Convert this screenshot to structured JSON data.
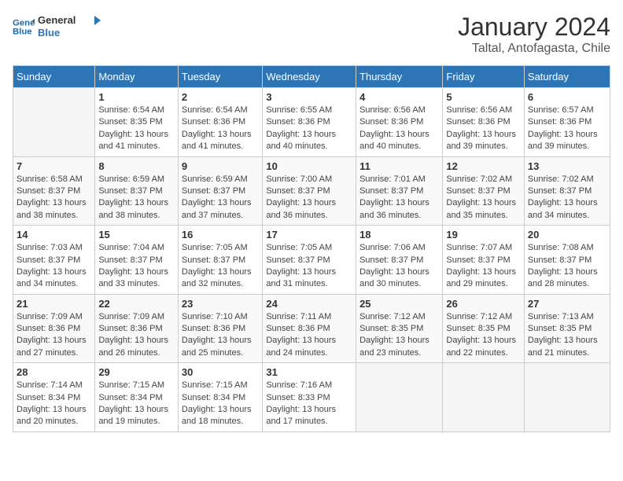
{
  "header": {
    "logo_line1": "General",
    "logo_line2": "Blue",
    "title": "January 2024",
    "subtitle": "Taltal, Antofagasta, Chile"
  },
  "weekdays": [
    "Sunday",
    "Monday",
    "Tuesday",
    "Wednesday",
    "Thursday",
    "Friday",
    "Saturday"
  ],
  "weeks": [
    [
      {
        "day": "",
        "sunrise": "",
        "sunset": "",
        "daylight": ""
      },
      {
        "day": "1",
        "sunrise": "Sunrise: 6:54 AM",
        "sunset": "Sunset: 8:35 PM",
        "daylight": "Daylight: 13 hours and 41 minutes."
      },
      {
        "day": "2",
        "sunrise": "Sunrise: 6:54 AM",
        "sunset": "Sunset: 8:36 PM",
        "daylight": "Daylight: 13 hours and 41 minutes."
      },
      {
        "day": "3",
        "sunrise": "Sunrise: 6:55 AM",
        "sunset": "Sunset: 8:36 PM",
        "daylight": "Daylight: 13 hours and 40 minutes."
      },
      {
        "day": "4",
        "sunrise": "Sunrise: 6:56 AM",
        "sunset": "Sunset: 8:36 PM",
        "daylight": "Daylight: 13 hours and 40 minutes."
      },
      {
        "day": "5",
        "sunrise": "Sunrise: 6:56 AM",
        "sunset": "Sunset: 8:36 PM",
        "daylight": "Daylight: 13 hours and 39 minutes."
      },
      {
        "day": "6",
        "sunrise": "Sunrise: 6:57 AM",
        "sunset": "Sunset: 8:36 PM",
        "daylight": "Daylight: 13 hours and 39 minutes."
      }
    ],
    [
      {
        "day": "7",
        "sunrise": "Sunrise: 6:58 AM",
        "sunset": "Sunset: 8:37 PM",
        "daylight": "Daylight: 13 hours and 38 minutes."
      },
      {
        "day": "8",
        "sunrise": "Sunrise: 6:59 AM",
        "sunset": "Sunset: 8:37 PM",
        "daylight": "Daylight: 13 hours and 38 minutes."
      },
      {
        "day": "9",
        "sunrise": "Sunrise: 6:59 AM",
        "sunset": "Sunset: 8:37 PM",
        "daylight": "Daylight: 13 hours and 37 minutes."
      },
      {
        "day": "10",
        "sunrise": "Sunrise: 7:00 AM",
        "sunset": "Sunset: 8:37 PM",
        "daylight": "Daylight: 13 hours and 36 minutes."
      },
      {
        "day": "11",
        "sunrise": "Sunrise: 7:01 AM",
        "sunset": "Sunset: 8:37 PM",
        "daylight": "Daylight: 13 hours and 36 minutes."
      },
      {
        "day": "12",
        "sunrise": "Sunrise: 7:02 AM",
        "sunset": "Sunset: 8:37 PM",
        "daylight": "Daylight: 13 hours and 35 minutes."
      },
      {
        "day": "13",
        "sunrise": "Sunrise: 7:02 AM",
        "sunset": "Sunset: 8:37 PM",
        "daylight": "Daylight: 13 hours and 34 minutes."
      }
    ],
    [
      {
        "day": "14",
        "sunrise": "Sunrise: 7:03 AM",
        "sunset": "Sunset: 8:37 PM",
        "daylight": "Daylight: 13 hours and 34 minutes."
      },
      {
        "day": "15",
        "sunrise": "Sunrise: 7:04 AM",
        "sunset": "Sunset: 8:37 PM",
        "daylight": "Daylight: 13 hours and 33 minutes."
      },
      {
        "day": "16",
        "sunrise": "Sunrise: 7:05 AM",
        "sunset": "Sunset: 8:37 PM",
        "daylight": "Daylight: 13 hours and 32 minutes."
      },
      {
        "day": "17",
        "sunrise": "Sunrise: 7:05 AM",
        "sunset": "Sunset: 8:37 PM",
        "daylight": "Daylight: 13 hours and 31 minutes."
      },
      {
        "day": "18",
        "sunrise": "Sunrise: 7:06 AM",
        "sunset": "Sunset: 8:37 PM",
        "daylight": "Daylight: 13 hours and 30 minutes."
      },
      {
        "day": "19",
        "sunrise": "Sunrise: 7:07 AM",
        "sunset": "Sunset: 8:37 PM",
        "daylight": "Daylight: 13 hours and 29 minutes."
      },
      {
        "day": "20",
        "sunrise": "Sunrise: 7:08 AM",
        "sunset": "Sunset: 8:37 PM",
        "daylight": "Daylight: 13 hours and 28 minutes."
      }
    ],
    [
      {
        "day": "21",
        "sunrise": "Sunrise: 7:09 AM",
        "sunset": "Sunset: 8:36 PM",
        "daylight": "Daylight: 13 hours and 27 minutes."
      },
      {
        "day": "22",
        "sunrise": "Sunrise: 7:09 AM",
        "sunset": "Sunset: 8:36 PM",
        "daylight": "Daylight: 13 hours and 26 minutes."
      },
      {
        "day": "23",
        "sunrise": "Sunrise: 7:10 AM",
        "sunset": "Sunset: 8:36 PM",
        "daylight": "Daylight: 13 hours and 25 minutes."
      },
      {
        "day": "24",
        "sunrise": "Sunrise: 7:11 AM",
        "sunset": "Sunset: 8:36 PM",
        "daylight": "Daylight: 13 hours and 24 minutes."
      },
      {
        "day": "25",
        "sunrise": "Sunrise: 7:12 AM",
        "sunset": "Sunset: 8:35 PM",
        "daylight": "Daylight: 13 hours and 23 minutes."
      },
      {
        "day": "26",
        "sunrise": "Sunrise: 7:12 AM",
        "sunset": "Sunset: 8:35 PM",
        "daylight": "Daylight: 13 hours and 22 minutes."
      },
      {
        "day": "27",
        "sunrise": "Sunrise: 7:13 AM",
        "sunset": "Sunset: 8:35 PM",
        "daylight": "Daylight: 13 hours and 21 minutes."
      }
    ],
    [
      {
        "day": "28",
        "sunrise": "Sunrise: 7:14 AM",
        "sunset": "Sunset: 8:34 PM",
        "daylight": "Daylight: 13 hours and 20 minutes."
      },
      {
        "day": "29",
        "sunrise": "Sunrise: 7:15 AM",
        "sunset": "Sunset: 8:34 PM",
        "daylight": "Daylight: 13 hours and 19 minutes."
      },
      {
        "day": "30",
        "sunrise": "Sunrise: 7:15 AM",
        "sunset": "Sunset: 8:34 PM",
        "daylight": "Daylight: 13 hours and 18 minutes."
      },
      {
        "day": "31",
        "sunrise": "Sunrise: 7:16 AM",
        "sunset": "Sunset: 8:33 PM",
        "daylight": "Daylight: 13 hours and 17 minutes."
      },
      {
        "day": "",
        "sunrise": "",
        "sunset": "",
        "daylight": ""
      },
      {
        "day": "",
        "sunrise": "",
        "sunset": "",
        "daylight": ""
      },
      {
        "day": "",
        "sunrise": "",
        "sunset": "",
        "daylight": ""
      }
    ]
  ]
}
